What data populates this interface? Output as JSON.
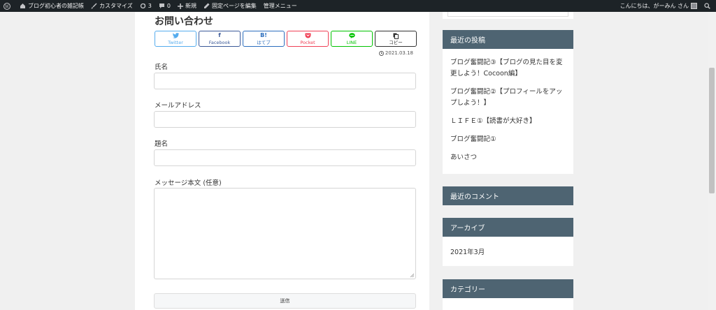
{
  "admin_bar": {
    "site_name": "ブログ初心者の雑記帳",
    "customize": "カスタマイズ",
    "updates_count": "3",
    "comments_count": "0",
    "new": "新規",
    "edit_fixed_page": "固定ページを編集",
    "admin_menu": "管理メニュー",
    "greeting": "こんにちは、がーみん さん"
  },
  "page": {
    "title": "お問い合わせ",
    "date": "2021.03.18"
  },
  "share": {
    "twitter": "Twitter",
    "facebook": "Facebook",
    "hatena": "はてブ",
    "pocket": "Pocket",
    "line": "LINE",
    "copy": "コピー"
  },
  "form": {
    "name_label": "氏名",
    "email_label": "メールアドレス",
    "subject_label": "題名",
    "message_label": "メッセージ本文 (任意)",
    "submit_label": "送信"
  },
  "sidebar": {
    "recent_posts_title": "最近の投稿",
    "recent_posts": [
      "ブログ奮闘記③【ブログの見た目を変更しよう！Cocoon編】",
      "ブログ奮闘記②【プロフィールをアップしよう！】",
      "ＬＩＦＥ①【読書が大好き】",
      "ブログ奮闘記①",
      "あいさつ"
    ],
    "recent_comments_title": "最近のコメント",
    "archives_title": "アーカイブ",
    "archive_items": [
      "2021年3月"
    ],
    "categories_title": "カテゴリー"
  }
}
